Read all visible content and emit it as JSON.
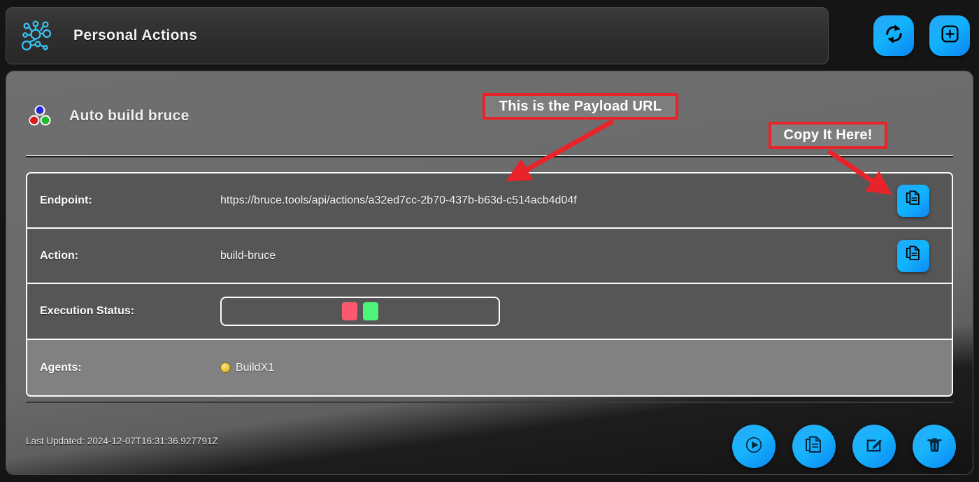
{
  "header": {
    "title": "Personal Actions",
    "logo_icon": "network-graph-icon",
    "buttons": [
      {
        "name": "refresh-button",
        "icon": "refresh-sync-icon"
      },
      {
        "name": "add-button",
        "icon": "plus-square-icon"
      }
    ]
  },
  "card": {
    "title": "Auto build bruce",
    "icon": "three-colored-nodes-icon",
    "rows": [
      {
        "label": "Endpoint:",
        "value": "https://bruce.tools/api/actions/a32ed7cc-2b70-437b-b63d-c514acb4d04f",
        "type": "text",
        "copy": true,
        "copy_icon": "copy-document-icon"
      },
      {
        "label": "Action:",
        "value": "build-bruce",
        "type": "text",
        "copy": true,
        "copy_icon": "copy-document-icon"
      },
      {
        "label": "Execution Status:",
        "type": "status",
        "chips": [
          {
            "color": "#fb5a6e",
            "state": "failed"
          },
          {
            "color": "#4ef57a",
            "state": "success"
          }
        ]
      },
      {
        "label": "Agents:",
        "type": "agents",
        "agents": [
          {
            "name": "BuildX1",
            "badge_icon": "agent-badge-icon"
          }
        ]
      }
    ]
  },
  "footer": {
    "last_updated": "Last Updated: 2024-12-07T16:31:36.927791Z",
    "buttons": [
      {
        "name": "run-button",
        "icon": "play-circle-icon"
      },
      {
        "name": "duplicate-button",
        "icon": "copy-document-icon"
      },
      {
        "name": "edit-button",
        "icon": "pencil-edit-icon"
      },
      {
        "name": "delete-button",
        "icon": "trash-delete-icon"
      }
    ]
  },
  "annotations": [
    {
      "name": "annotation-payload-url",
      "text": "This is the Payload URL"
    },
    {
      "name": "annotation-copy-here",
      "text": "Copy It Here!"
    }
  ],
  "colors": {
    "accent_blue": "#12b3fb",
    "annotation_red": "#e8232a",
    "status_failed": "#fb5a6e",
    "status_success": "#4ef57a"
  }
}
